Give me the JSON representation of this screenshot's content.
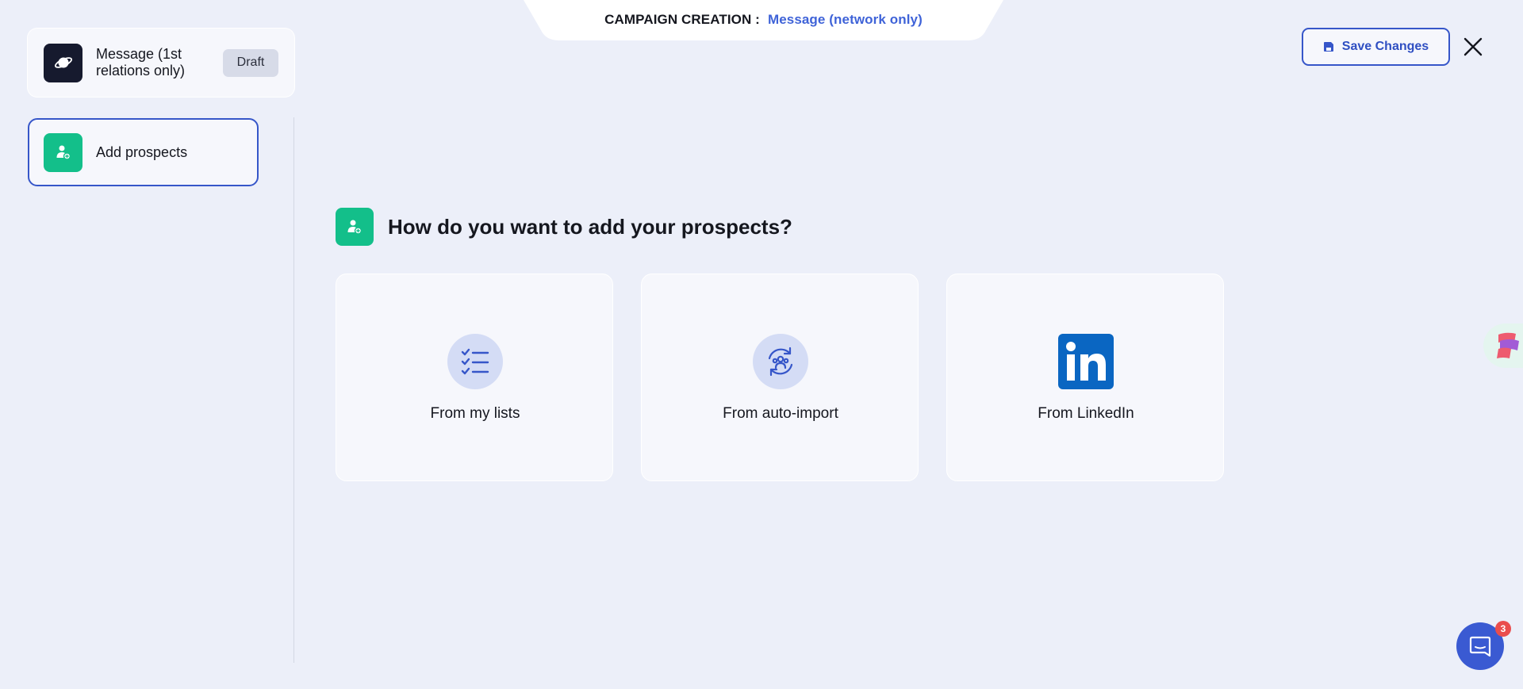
{
  "header": {
    "prefix": "CAMPAIGN CREATION :",
    "campaign_type": "Message (network only)"
  },
  "campaign": {
    "name": "Message (1st relations only)",
    "status": "Draft",
    "icon": "planet-icon"
  },
  "steps": [
    {
      "label": "Add prospects",
      "icon": "user-add-icon",
      "active": true
    }
  ],
  "main": {
    "question": "How do you want to add your prospects?",
    "options": [
      {
        "label": "From my lists",
        "icon": "checklist-icon"
      },
      {
        "label": "From auto-import",
        "icon": "sync-users-icon"
      },
      {
        "label": "From LinkedIn",
        "icon": "linkedin-icon"
      }
    ]
  },
  "toolbar": {
    "save_label": "Save Changes",
    "close_icon": "close-icon"
  },
  "chat": {
    "unread_count": "3"
  },
  "colors": {
    "background": "#eceff9",
    "accent": "#3656c9",
    "green": "#13bf8a",
    "linkedin": "#0a66c2",
    "badge": "#ea4d4d"
  }
}
